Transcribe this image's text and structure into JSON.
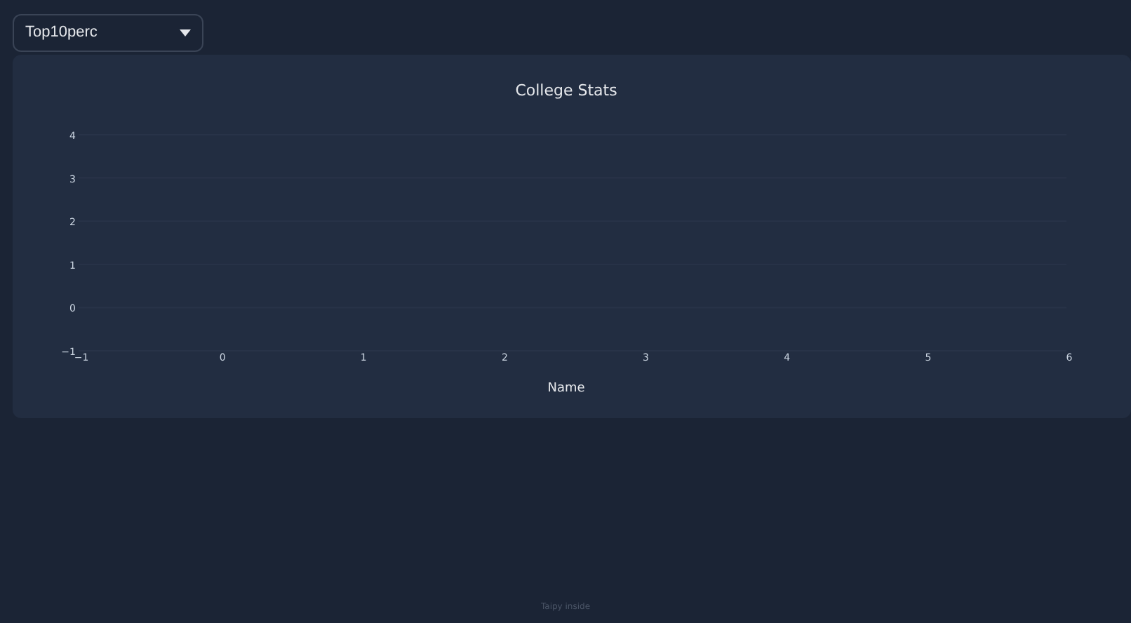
{
  "selector": {
    "value": "Top10perc"
  },
  "chart": {
    "chart_data": {
      "type": "line",
      "title": "College Stats",
      "xlabel": "Name",
      "xlim": [
        -1,
        6
      ],
      "ylim": [
        -1,
        4
      ],
      "xticks": [
        -1,
        0,
        1,
        2,
        3,
        4,
        5,
        6
      ],
      "yticks": [
        -1,
        0,
        1,
        2,
        3,
        4
      ],
      "grid": true
    }
  },
  "footer": {
    "text": "Taipy inside"
  }
}
